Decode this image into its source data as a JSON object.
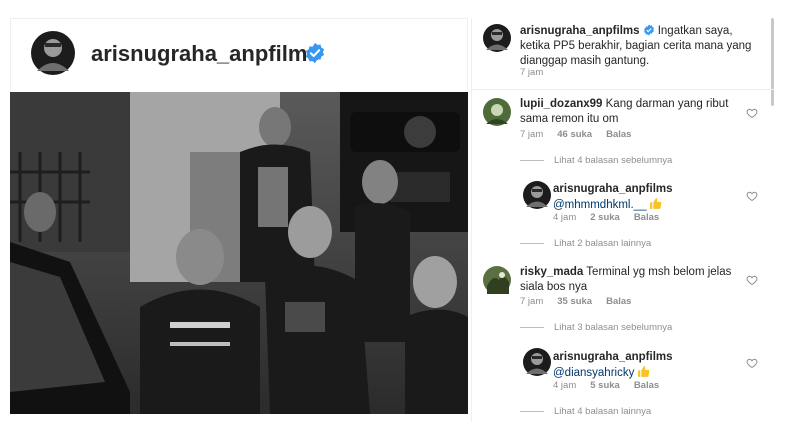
{
  "post": {
    "username": "arisnugraha_anpfilms"
  },
  "caption": {
    "username": "arisnugraha_anpfilms",
    "text_line1": "Ingatkan saya,",
    "text_line2": "ketika PP5 berakhir, bagian cerita mana yang",
    "text_line3": "dianggap masih gantung.",
    "time": "7 jam"
  },
  "comments": [
    {
      "username": "lupii_dozanx99",
      "line1": "Kang darman yang ribut",
      "line2": "sama remon itu om",
      "time": "7 jam",
      "likes": "46 suka",
      "reply": "Balas",
      "view_replies": "Lihat 4 balasan sebelumnya"
    },
    {
      "username": "arisnugraha_anpfilms",
      "mention": "@mhmmdhkml.__",
      "time": "4 jam",
      "likes": "2 suka",
      "reply": "Balas",
      "view_replies": "Lihat 2 balasan lainnya"
    },
    {
      "username": "risky_mada",
      "line1": "Terminal yg msh belom jelas",
      "line2": "siala bos nya",
      "time": "7 jam",
      "likes": "35 suka",
      "reply": "Balas",
      "view_replies": "Lihat 3 balasan sebelumnya"
    },
    {
      "username": "arisnugraha_anpfilms",
      "mention": "@diansyahricky",
      "time": "4 jam",
      "likes": "5 suka",
      "reply": "Balas",
      "view_replies": "Lihat 4 balasan lainnya"
    }
  ],
  "colors": {
    "verified": "#3897f0",
    "muted": "#8e8e8e",
    "mention": "#00376b",
    "emoji": "#f7c325"
  },
  "icons": {
    "verified": "verified-badge-icon",
    "like": "heart-icon",
    "thumbs_up": "thumbs-up-emoji"
  }
}
